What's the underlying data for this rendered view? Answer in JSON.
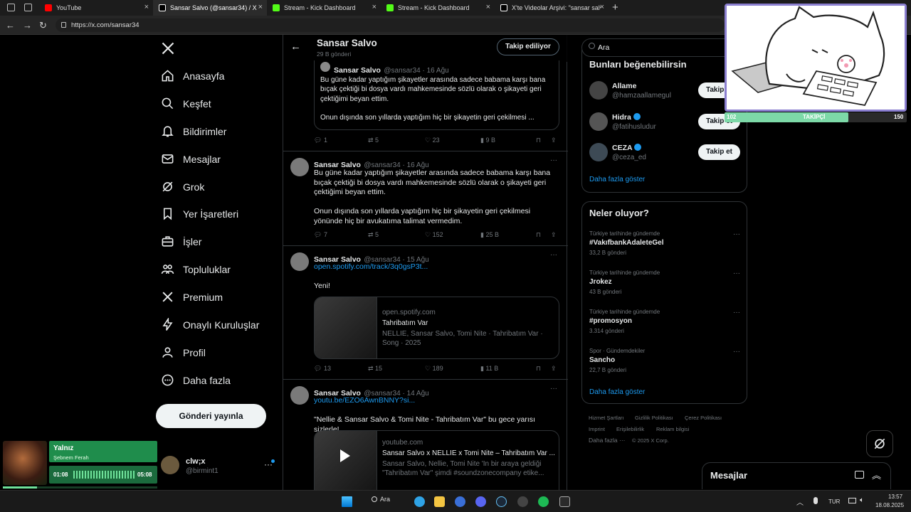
{
  "browser": {
    "tabs": [
      {
        "title": "YouTube",
        "favicon_color": "#ff0000"
      },
      {
        "title": "Sansar Salvo (@sansar34) / X",
        "favicon_color": "#ffffff"
      },
      {
        "title": "Stream - Kick Dashboard",
        "favicon_color": "#53fc18"
      },
      {
        "title": "Stream - Kick Dashboard",
        "favicon_color": "#53fc18"
      },
      {
        "title": "X'te Videolar Arşivi: \"sansar salvo",
        "favicon_color": "#ffffff"
      }
    ],
    "url": "https://x.com/sansar34"
  },
  "nav": {
    "items": [
      {
        "label": "Anasayfa",
        "icon": "home-icon"
      },
      {
        "label": "Keşfet",
        "icon": "search-icon"
      },
      {
        "label": "Bildirimler",
        "icon": "bell-icon"
      },
      {
        "label": "Mesajlar",
        "icon": "mail-icon"
      },
      {
        "label": "Grok",
        "icon": "grok-icon"
      },
      {
        "label": "Yer İşaretleri",
        "icon": "bookmark-icon"
      },
      {
        "label": "İşler",
        "icon": "briefcase-icon"
      },
      {
        "label": "Topluluklar",
        "icon": "people-icon"
      },
      {
        "label": "Premium",
        "icon": "x-logo-icon"
      },
      {
        "label": "Onaylı Kuruluşlar",
        "icon": "lightning-icon"
      },
      {
        "label": "Profil",
        "icon": "person-icon"
      },
      {
        "label": "Daha fazla",
        "icon": "more-circle-icon"
      }
    ],
    "post_button": "Gönderi yayınla",
    "account": {
      "name": "clw;x",
      "handle": "@birmint1"
    }
  },
  "profile_header": {
    "name": "Sansar Salvo",
    "posts_count": "29 B gönderi",
    "follow_button": "Takip ediliyor"
  },
  "tweets": [
    {
      "quote_name": "Sansar Salvo",
      "quote_meta": "@sansar34 · 16 Ağu",
      "quote_text": "Bu güne kadar yaptığım şikayetler arasında sadece babama karşı bana bıçak çektiği bi dosya vardı mahkemesinde sözlü olarak o şikayeti geri çektiğimi beyan ettim.\n\nOnun dışında son yıllarda yaptığım hiç bir şikayetin geri çekilmesi ...",
      "replies": "1",
      "reposts": "5",
      "likes": "23",
      "views": "9 B"
    },
    {
      "name": "Sansar Salvo",
      "meta": "@sansar34 · 16 Ağu",
      "text": "Bu güne kadar yaptığım şikayetler arasında sadece babama karşı bana bıçak çektiği bi dosya vardı mahkemesinde sözlü olarak o şikayeti geri çektiğimi beyan ettim.\n\nOnun dışında son yıllarda yaptığım hiç bir şikayetin geri çekilmesi yönünde hiç bir avukatıma talimat vermedim.",
      "replies": "7",
      "reposts": "5",
      "likes": "152",
      "views": "25 B"
    },
    {
      "name": "Sansar Salvo",
      "meta": "@sansar34 · 15 Ağu",
      "link": "open.spotify.com/track/3q0gsP3t...",
      "text": "Yeni!",
      "card": {
        "domain": "open.spotify.com",
        "title": "Tahribatım Var",
        "desc": "NELLIE, Sansar Salvo, Tomi Nite · Tahribatım Var · Song · 2025"
      },
      "replies": "13",
      "reposts": "15",
      "likes": "189",
      "views": "11 B"
    },
    {
      "name": "Sansar Salvo",
      "meta": "@sansar34 · 14 Ağu",
      "link": "youtu.be/EZO6AwnBNNY?si...",
      "text": "\"Nellie & Sansar Salvo & Tomi Nite - Tahribatım Var\" bu gece yarısı sizlerle!",
      "card": {
        "domain": "youtube.com",
        "title": "Sansar Salvo x NELLIE x Tomi Nite – Tahribatım Var ...",
        "desc": "Sansar Salvo, Nellie, Tomi Nite 'In bir araya geldiği \"Tahribatım Var\" şimdi #soundzonecompany etike..."
      }
    }
  ],
  "sidebar": {
    "search_placeholder": "Ara",
    "suggestions_title": "Bunları beğenebilirsin",
    "suggestions": [
      {
        "name": "Allame",
        "handle": "@hamzaallamegul",
        "button": "Takip et"
      },
      {
        "name": "Hidra",
        "handle": "@fatihusludur",
        "button": "Takip et"
      },
      {
        "name": "CEZA",
        "handle": "@ceza_ed",
        "button": "Takip et"
      }
    ],
    "show_more": "Daha fazla göster",
    "trends_title": "Neler oluyor?",
    "trends": [
      {
        "category": "Türkiye tarihinde gündemde",
        "tag": "#VakıfbankAdaleteGel",
        "count": "33,2 B gönderi"
      },
      {
        "category": "Türkiye tarihinde gündemde",
        "tag": "Jrokez",
        "count": "43 B gönderi"
      },
      {
        "category": "Türkiye tarihinde gündemde",
        "tag": "#promosyon",
        "count": "3.314 gönderi"
      },
      {
        "category": "Spor · Gündemdekiler",
        "tag": "Sancho",
        "count": "22,7 B gönderi"
      }
    ],
    "footer": [
      "Hizmet Şartları",
      "Gizlilik Politikası",
      "Çerez Politikası",
      "Imprint",
      "Erişilebilirlik",
      "Reklam bilgisi",
      "Daha fazla ···",
      "© 2025 X Corp."
    ]
  },
  "messages_drawer": {
    "title": "Mesajlar"
  },
  "overlay": {
    "followers_label": "TAKİPÇİ",
    "followers_current": "102",
    "followers_goal": "150",
    "progress": 0.68
  },
  "music": {
    "title": "Yalnız",
    "artist": "Şebnem Ferah",
    "elapsed": "01:08",
    "total": "05:08",
    "progress": 0.22
  },
  "taskbar": {
    "search_label": "Ara",
    "language": "TUR",
    "time": "13:57",
    "date": "18.08.2025"
  }
}
